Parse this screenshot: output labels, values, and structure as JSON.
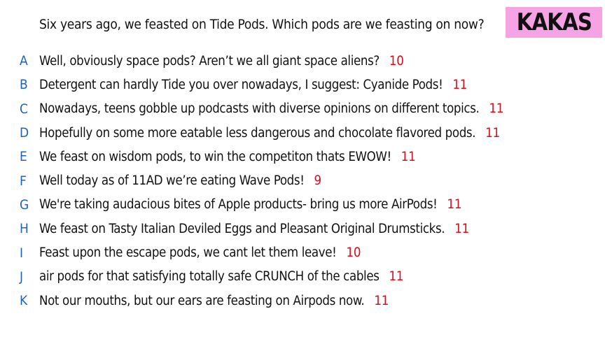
{
  "prompt": "Six years ago, we feasted on Tide Pods. Which pods are we feasting on now?",
  "badge": "KAKAS",
  "colors": {
    "letter": "#1f63b8",
    "score": "#d10f1f",
    "badge_bg": "#f6a3e6",
    "text": "#111111"
  },
  "answers": [
    {
      "letter": "A",
      "text": "Well, obviously space pods? Aren’t we all giant space aliens?",
      "score": "10"
    },
    {
      "letter": "B",
      "text": "Detergent can hardly Tide you over nowadays, I suggest: Cyanide Pods!",
      "score": "11"
    },
    {
      "letter": "C",
      "text": "Nowadays, teens gobble up podcasts with diverse opinions on different topics.",
      "score": "11"
    },
    {
      "letter": "D",
      "text": "Hopefully on some more eatable less dangerous and chocolate flavored pods.",
      "score": "11"
    },
    {
      "letter": "E",
      "text": "We feast on wisdom pods, to win the competiton thats EWOW!",
      "score": "11"
    },
    {
      "letter": "F",
      "text": "Well today as of 11AD we’re eating Wave Pods!",
      "score": "9"
    },
    {
      "letter": "G",
      "text": "We're taking audacious bites of Apple products- bring us more AirPods!",
      "score": "11"
    },
    {
      "letter": "H",
      "text": "We feast on Tasty Italian Deviled Eggs and Pleasant Original Drumsticks.",
      "score": "11"
    },
    {
      "letter": "I",
      "text": "Feast upon the escape pods, we cant let them leave!",
      "score": "10"
    },
    {
      "letter": "J",
      "text": "air pods for that satisfying totally safe CRUNCH of the cables",
      "score": "11"
    },
    {
      "letter": "K",
      "text": "Not our mouths, but our ears are feasting on Airpods now.",
      "score": "11"
    }
  ]
}
